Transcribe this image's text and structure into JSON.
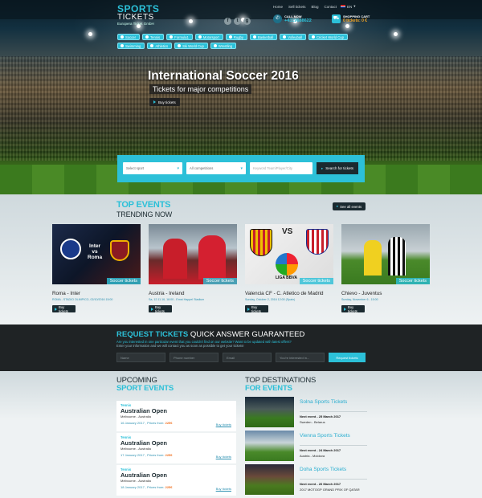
{
  "header": {
    "logo_line1": "SPORTS",
    "logo_line2": "TICKETS",
    "logo_line3": "Europera Ticket GmbH",
    "nav": [
      "Home",
      "Sell tickets",
      "Blog",
      "Contact"
    ],
    "lang": "EN",
    "call_label": "CALL NOW",
    "call_number": "+4319688622",
    "cart_label": "SHOPPING CART",
    "cart_value": "0 tickets: 0 €",
    "social": [
      "f",
      "t",
      "g"
    ]
  },
  "categories": [
    "Soccer",
    "Tennis",
    "Formula1",
    "Motorsport",
    "Rugby",
    "Basketball",
    "Volleyball",
    "Cricket World Cup",
    "Swimming",
    "Athletics",
    "Ski World Cup",
    "Wrestling"
  ],
  "hero": {
    "title": "International Soccer 2016",
    "subtitle": "Tickets for major competitions",
    "button": "Buy tickets"
  },
  "search": {
    "sport_placeholder": "Select sport",
    "competition_placeholder": "All competitions",
    "keyword_placeholder": "Keyword Team/Player/City",
    "button": "Search for tickets"
  },
  "top_events": {
    "title1": "TOP EVENTS",
    "title2": "TRENDING NOW",
    "see_all": "See all events",
    "cards": [
      {
        "title": "Roma - Inter",
        "meta": "ROMA - STADIO OLIMPICO, 02/10/2016 15:00",
        "tag": "Soccer tickets",
        "button": "Buy tickets",
        "img_text1": "Inter",
        "img_text2": "vs",
        "img_text3": "Roma"
      },
      {
        "title": "Austria - Ireland",
        "meta": "Sa, 12.11.16, 18:00 - Ernst Happel Stadium",
        "tag": "Soccer tickets",
        "button": "Buy tickets"
      },
      {
        "title": "Valencia CF - C. Atletico de Madrid",
        "meta": "Sunday, October 2, 2016 12:00 (Spain)",
        "tag": "Soccer tickets",
        "button": "Buy tickets",
        "img_text1": "VS",
        "img_text2": "LIGA BBVA"
      },
      {
        "title": "Chievo - Juventus",
        "meta": "Sunday, November 6 - 15:00",
        "tag": "Soccer tickets",
        "button": "Buy tickets"
      }
    ]
  },
  "request": {
    "title": "REQUEST TICKETS",
    "title_suffix": "QUICK ANSWER GUARANTEED",
    "text1": "Are you interested in one particular event that you couldn't find on our website? Want to be updated with latest offers?",
    "text2": "Enter your information and we will contact you as soon as possible to get your tickets!",
    "fields": [
      "Name",
      "Phone number",
      "Email",
      "You're interested in..."
    ],
    "button": "Request tickets"
  },
  "upcoming": {
    "title1": "UPCOMING",
    "title2": "SPORT EVENTS",
    "items": [
      {
        "sport": "Tennis",
        "name": "Australian Open",
        "location": "Melbourne - Australia",
        "date": "16 January 2017 , Prices from:",
        "price": "225€",
        "link": "Buy tickets"
      },
      {
        "sport": "Tennis",
        "name": "Australian Open",
        "location": "Melbourne - Australia",
        "date": "17 January 2017 , Prices from:",
        "price": "225€",
        "link": "Buy tickets"
      },
      {
        "sport": "Tennis",
        "name": "Australian Open",
        "location": "Melbourne - Australia",
        "date": "18 January 2017 , Prices from:",
        "price": "225€",
        "link": "Buy tickets"
      }
    ]
  },
  "destinations": {
    "title1": "TOP DESTINATIONS",
    "title2": "FOR EVENTS",
    "items": [
      {
        "name": "Solna Sports Tickets",
        "next": "Next event - 25 March 2017",
        "sub": "Sweden - Belarus"
      },
      {
        "name": "Vienna Sports Tickets",
        "next": "Next event - 24 March 2017",
        "sub": "Austria - Moldova"
      },
      {
        "name": "Doha Sports Tickets",
        "next": "Next event - 26 March 2017",
        "sub": "2017 MOTOGP GRAND PRIX OF QATAR"
      }
    ]
  },
  "colors": {
    "accent": "#2cc0d8",
    "dark": "#1b2a30",
    "price": "#f07020"
  }
}
